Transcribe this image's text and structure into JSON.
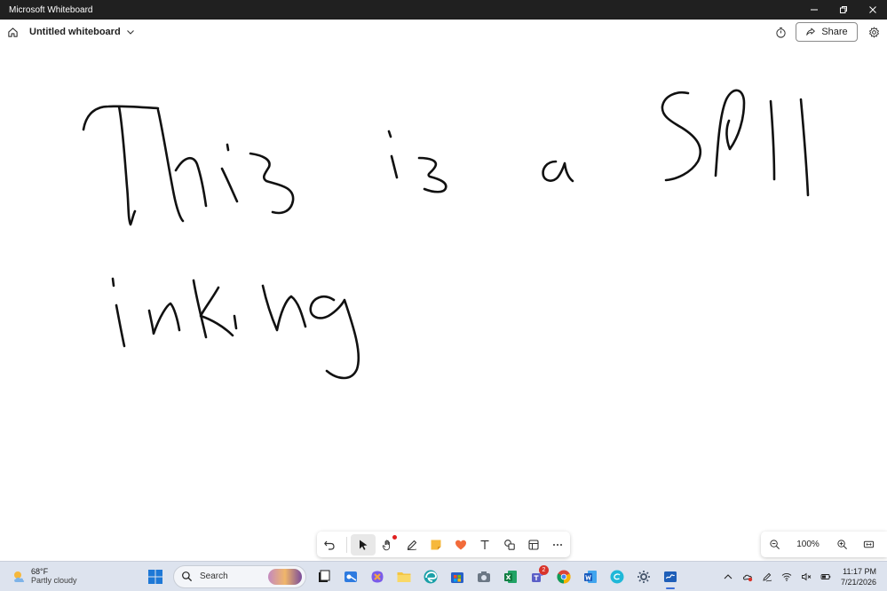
{
  "window": {
    "title": "Microsoft Whiteboard"
  },
  "header": {
    "board_name": "Untitled whiteboard",
    "share_label": "Share"
  },
  "canvas": {
    "ink_color": "#111111"
  },
  "zoom": {
    "level": "100%"
  },
  "taskbar": {
    "weather": {
      "temp": "68°F",
      "condition": "Partly cloudy"
    },
    "search_label": "Search",
    "teams_badge": "2",
    "time": "11:17 PM",
    "date": "7/21/2026"
  },
  "icons": {
    "titlebar": [
      "minimize-icon",
      "restore-icon",
      "close-icon"
    ],
    "header": [
      "home-icon",
      "chevron-down-icon",
      "timer-icon",
      "share-icon",
      "gear-icon"
    ],
    "toolbar": [
      "undo-icon",
      "select-icon",
      "hand-icon",
      "pen-icon",
      "sticky-note-icon",
      "reaction-icon",
      "text-icon",
      "shapes-icon",
      "templates-icon",
      "more-icon"
    ],
    "zoom": [
      "zoom-out-icon",
      "zoom-in-icon",
      "fit-screen-icon"
    ]
  },
  "colors": {
    "titlebar": "#202020",
    "taskbar": "#dde3ee",
    "accent": "#3b6fd8",
    "reaction": "#f26b3a",
    "sticky": "#f6b83c"
  }
}
